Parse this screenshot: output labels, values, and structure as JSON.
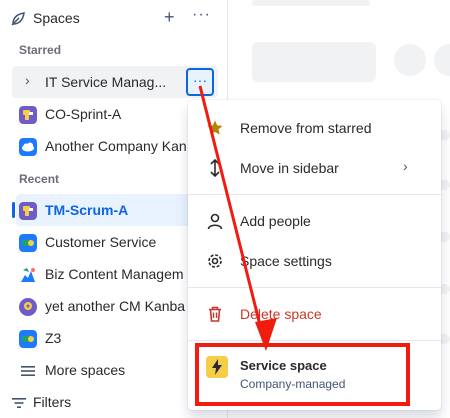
{
  "sidebar": {
    "title": "Spaces",
    "starred_label": "Starred",
    "recent_label": "Recent",
    "more_spaces": "More spaces",
    "filters": "Filters",
    "starred_items": [
      {
        "label": "IT Service Manag..."
      },
      {
        "label": "CO-Sprint-A"
      },
      {
        "label": "Another Company Kan"
      }
    ],
    "recent_items": [
      {
        "label": "TM-Scrum-A"
      },
      {
        "label": "Customer Service"
      },
      {
        "label": "Biz Content Managem"
      },
      {
        "label": "yet another CM Kanba"
      },
      {
        "label": "Z3"
      }
    ]
  },
  "menu": {
    "items": [
      {
        "label": "Remove from starred"
      },
      {
        "label": "Move in sidebar"
      },
      {
        "label": "Add people"
      },
      {
        "label": "Space settings"
      },
      {
        "label": "Delete space"
      }
    ],
    "service": {
      "title": "Service space",
      "subtitle": "Company-managed"
    }
  },
  "colors": {
    "accent": "#0c66e4",
    "danger": "#c9372c",
    "annotation_red": "#ef1c0f"
  }
}
